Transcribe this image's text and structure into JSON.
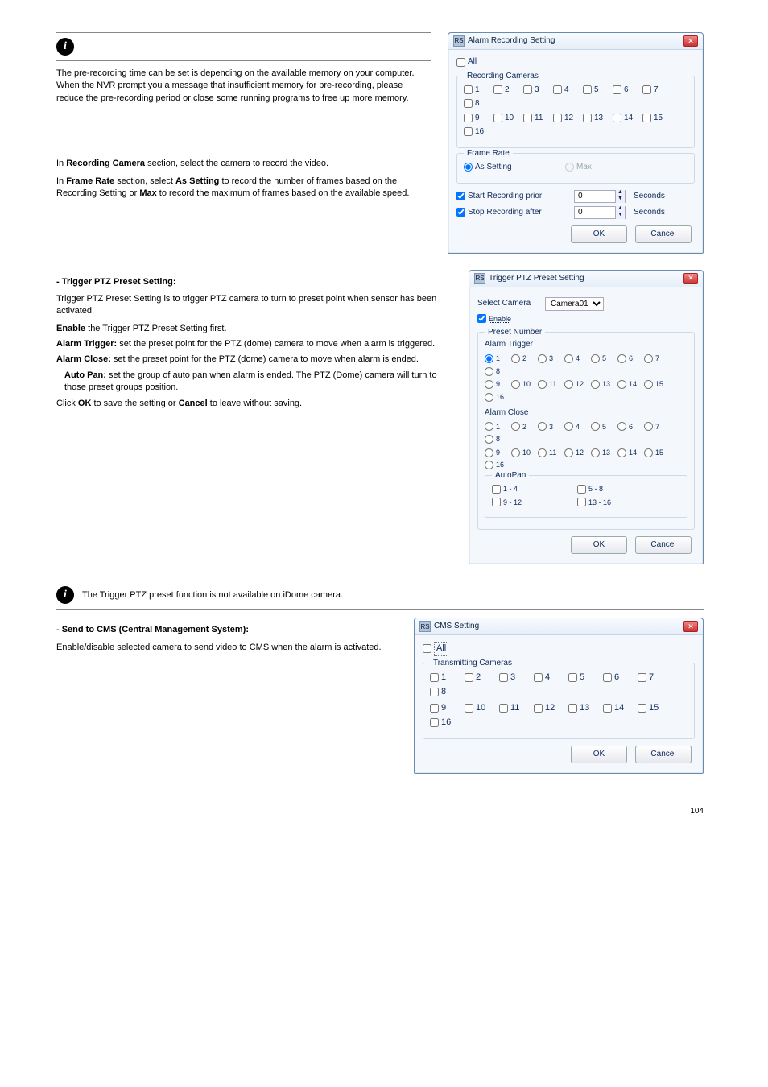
{
  "pageNumber": "104",
  "infoBlock1": {
    "text": "The pre-recording time can be set is depending on the available memory on your computer. When the NVR prompt you a message that insufficient memory for pre-recording, please reduce the pre-recording period or close some running programs to free up more memory."
  },
  "sectionText1": {
    "line1a": "In ",
    "line1b": "Recording Camera",
    "line1c": " section, select the camera to record the video.",
    "line2a": "In ",
    "line2b": "Frame Rate",
    "line2c": " section, select ",
    "line2d": "As Setting",
    "line2e": " to record the number of frames based on the Recording Setting or ",
    "line2f": "Max",
    "line2g": " to record the maximum of frames based on the available speed."
  },
  "ptzSection": {
    "head1": "- Trigger PTZ Preset Setting:",
    "desc1": "Trigger PTZ Preset Setting is to trigger PTZ camera to turn to preset point when sensor has been activated.",
    "sub1": "Enable",
    "sub1d": " the Trigger PTZ Preset Setting first.",
    "sub2": "Alarm Trigger:",
    "sub2d": " set the preset point for the PTZ (dome) camera to move when alarm is triggered.",
    "sub3": "Alarm Close:",
    "sub3d": " set the preset point for the PTZ (dome) camera to move when alarm is ended.",
    "sub3a": "Auto Pan: ",
    "sub3ad": "set the group of auto pan when alarm is ended. The PTZ (Dome) camera will turn to those preset groups position.",
    "tail": "Click ",
    "tailb": "OK ",
    "taild": "to save the setting or ",
    "tailc": "Cancel",
    "taile": " to leave without saving."
  },
  "infoBlock2": {
    "text": "The Trigger PTZ preset function is not available on iDome camera."
  },
  "cmsSection": {
    "head": "- Send to CMS (Central Management System):",
    "d1": "Enable/disable selected camera to send video to CMS when the alarm is activated."
  },
  "alarmDialog": {
    "title": "Alarm Recording Setting",
    "all": "All",
    "grpRecording": "Recording Cameras",
    "cams": [
      "1",
      "2",
      "3",
      "4",
      "5",
      "6",
      "7",
      "8",
      "9",
      "10",
      "11",
      "12",
      "13",
      "14",
      "15",
      "16"
    ],
    "grpFrame": "Frame Rate",
    "asSetting": "As Setting",
    "max": "Max",
    "startPrior": "Start Recording prior",
    "stopAfter": "Stop Recording after",
    "valPrior": "0",
    "valAfter": "0",
    "seconds": "Seconds",
    "ok": "OK",
    "cancel": "Cancel"
  },
  "ptzDialog": {
    "title": "Trigger PTZ Preset Setting",
    "selectCamera": "Select Camera",
    "camera": "Camera01",
    "enable": "Enable",
    "presetNumber": "Preset Number",
    "alarmTrigger": "Alarm Trigger",
    "alarmClose": "Alarm Close",
    "presets": [
      "1",
      "2",
      "3",
      "4",
      "5",
      "6",
      "7",
      "8",
      "9",
      "10",
      "11",
      "12",
      "13",
      "14",
      "15",
      "16"
    ],
    "autoPan": "AutoPan",
    "ap1": "1 - 4",
    "ap2": "5 - 8",
    "ap3": "9 - 12",
    "ap4": "13 - 16",
    "ok": "OK",
    "cancel": "Cancel"
  },
  "cmsDialog": {
    "title": "CMS Setting",
    "all": "All",
    "grp": "Transmitting Cameras",
    "cams": [
      "1",
      "2",
      "3",
      "4",
      "5",
      "6",
      "7",
      "8",
      "9",
      "10",
      "11",
      "12",
      "13",
      "14",
      "15",
      "16"
    ],
    "ok": "OK",
    "cancel": "Cancel"
  }
}
